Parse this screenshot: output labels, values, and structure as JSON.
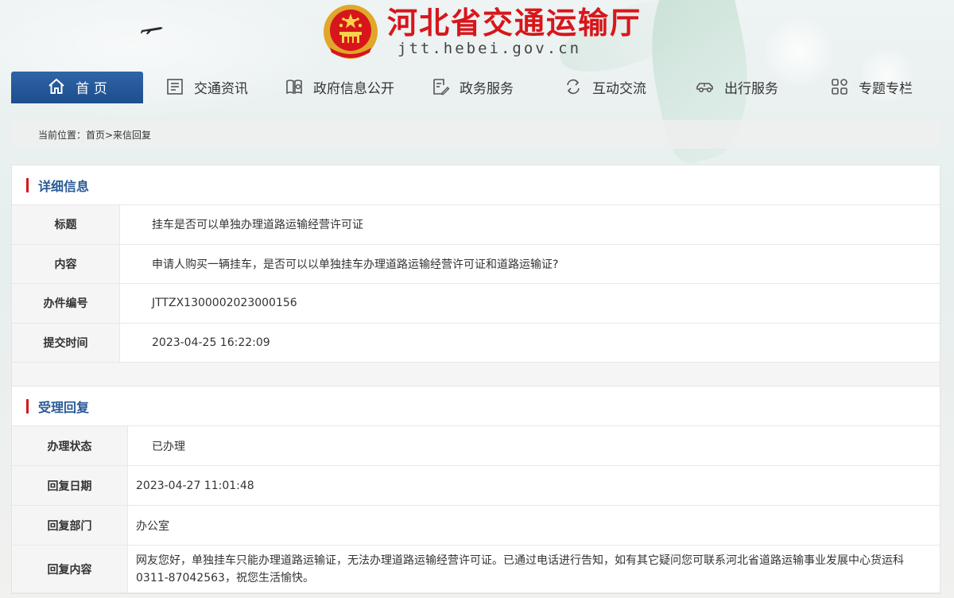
{
  "header": {
    "site_title": "河北省交通运输厅",
    "site_domain": "jtt.hebei.gov.cn"
  },
  "nav": [
    {
      "label": "首 页",
      "icon": "home-icon"
    },
    {
      "label": "交通资讯",
      "icon": "news-icon"
    },
    {
      "label": "政府信息公开",
      "icon": "book-icon"
    },
    {
      "label": "政务服务",
      "icon": "edit-doc-icon"
    },
    {
      "label": "互动交流",
      "icon": "exchange-icon"
    },
    {
      "label": "出行服务",
      "icon": "car-icon"
    },
    {
      "label": "专题专栏",
      "icon": "grid-icon"
    }
  ],
  "breadcrumb": "当前位置：首页>来信回复",
  "detail": {
    "heading": "详细信息",
    "rows": [
      {
        "label": "标题",
        "value": "挂车是否可以单独办理道路运输经营许可证"
      },
      {
        "label": "内容",
        "value": "申请人购买一辆挂车，是否可以以单独挂车办理道路运输经营许可证和道路运输证?"
      },
      {
        "label": "办件编号",
        "value": "JTTZX1300002023000156"
      },
      {
        "label": "提交时间",
        "value": "2023-04-25 16:22:09"
      }
    ]
  },
  "reply": {
    "heading": "受理回复",
    "rows": [
      {
        "label": "办理状态",
        "value": "已办理"
      },
      {
        "label": "回复日期",
        "value": "2023-04-27 11:01:48"
      },
      {
        "label": "回复部门",
        "value": "办公室"
      },
      {
        "label": "回复内容",
        "value": "网友您好，单独挂车只能办理道路运输证，无法办理道路运输经营许可证。已通过电话进行告知，如有其它疑问您可联系河北省道路运输事业发展中心货运科0311-87042563，祝您生活愉快。"
      }
    ]
  },
  "colors": {
    "brand_red": "#d7161b",
    "nav_blue": "#1e4f8f",
    "heading_blue": "#2a5a97",
    "status_green": "#2f8f2f"
  }
}
